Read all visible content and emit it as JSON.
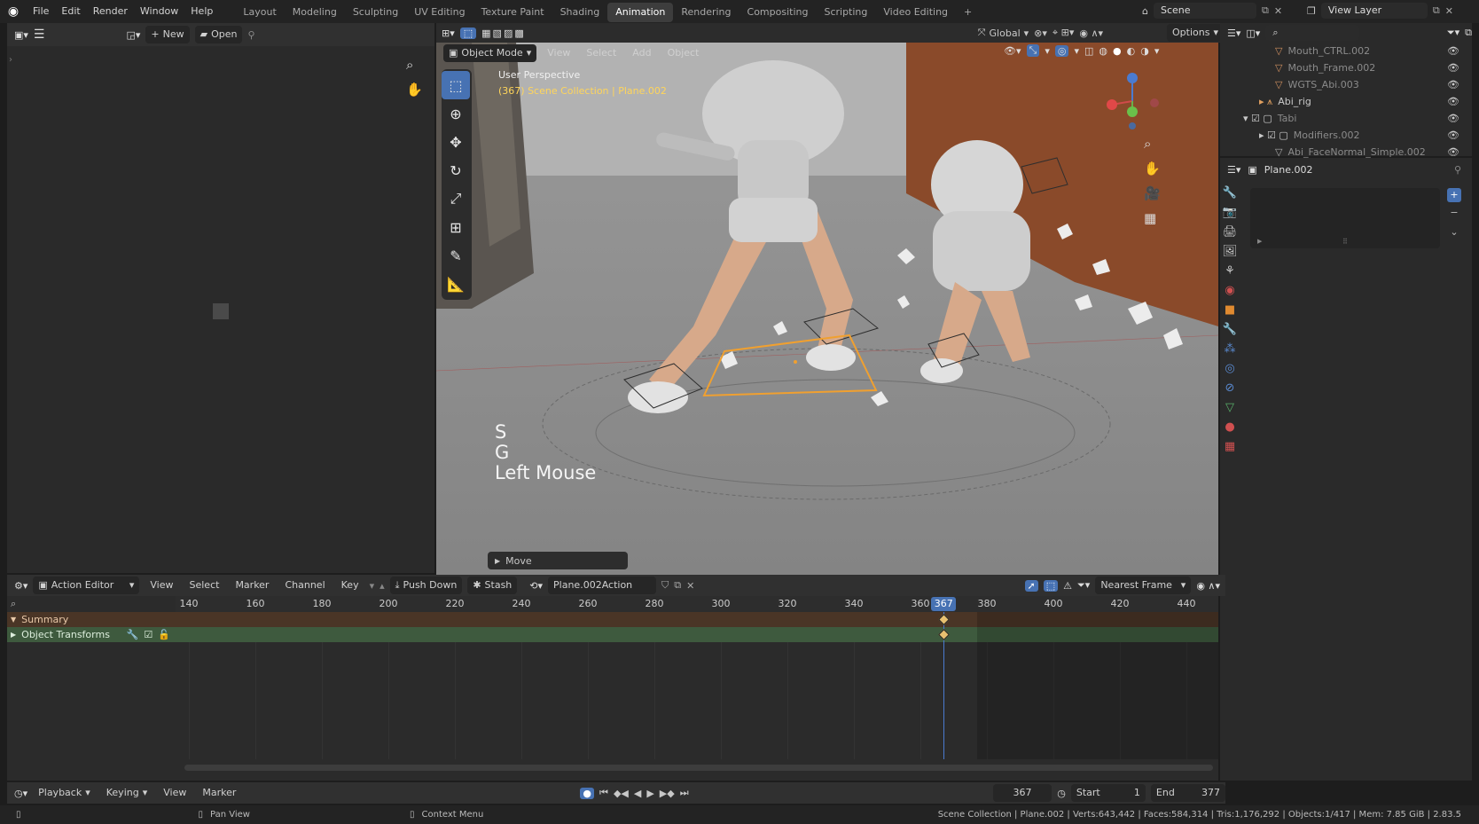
{
  "topbar": {
    "menus": [
      "File",
      "Edit",
      "Render",
      "Window",
      "Help"
    ],
    "workspaces": [
      "Layout",
      "Modeling",
      "Sculpting",
      "UV Editing",
      "Texture Paint",
      "Shading",
      "Animation",
      "Rendering",
      "Compositing",
      "Scripting",
      "Video Editing"
    ],
    "active_workspace": "Animation",
    "add_workspace": "+",
    "scene": "Scene",
    "view_layer": "View Layer"
  },
  "left_panel": {
    "new_label": "New",
    "open_label": "Open"
  },
  "viewport": {
    "mode": "Object Mode",
    "menus": [
      "View",
      "Select",
      "Add",
      "Object"
    ],
    "orientation": "Global",
    "options": "Options",
    "overlay_title": "User Perspective",
    "overlay_sub": "(367) Scene Collection | Plane.002",
    "keys": [
      "S",
      "G",
      "Left Mouse"
    ],
    "last_op": "Move",
    "gizmo": {
      "x": "X",
      "y": "Y",
      "z": "Z"
    }
  },
  "dopesheet": {
    "editor": "Action Editor",
    "menus": [
      "View",
      "Select",
      "Marker",
      "Channel",
      "Key"
    ],
    "push_down": "Push Down",
    "stash": "Stash",
    "action": "Plane.002Action",
    "snap": "Nearest Frame",
    "current_frame": "367",
    "frame_labels": [
      "140",
      "160",
      "180",
      "200",
      "220",
      "240",
      "260",
      "280",
      "300",
      "320",
      "340",
      "360",
      "380",
      "400",
      "420",
      "440"
    ],
    "channels": [
      "Summary",
      "Object Transforms"
    ]
  },
  "timeline": {
    "menus": [
      "Playback",
      "Keying",
      "View",
      "Marker"
    ],
    "frame": "367",
    "start_label": "Start",
    "start": "1",
    "end_label": "End",
    "end": "377"
  },
  "statusbar": {
    "pan": "Pan View",
    "context": "Context Menu",
    "stats": "Scene Collection | Plane.002 | Verts:643,442 | Faces:584,314 | Tris:1,176,292 | Objects:1/417 | Mem: 7.85 GiB | 2.83.5"
  },
  "outliner": {
    "items": [
      "Mouth_CTRL.002",
      "Mouth_Frame.002",
      "WGTS_Abi.003",
      "Abi_rig",
      "Tabi",
      "Modifiers.002",
      "Abi_FaceNormal_Simple.002"
    ]
  },
  "properties": {
    "object_name": "Plane.002"
  },
  "colors": {
    "accent": "#4772b3",
    "active_tab": "#3d3d3d",
    "keyframe_line": "#4a7bd0",
    "summary_row": "#4a3526",
    "transforms_row": "#3e5a3e",
    "selection": "#f0a030"
  }
}
